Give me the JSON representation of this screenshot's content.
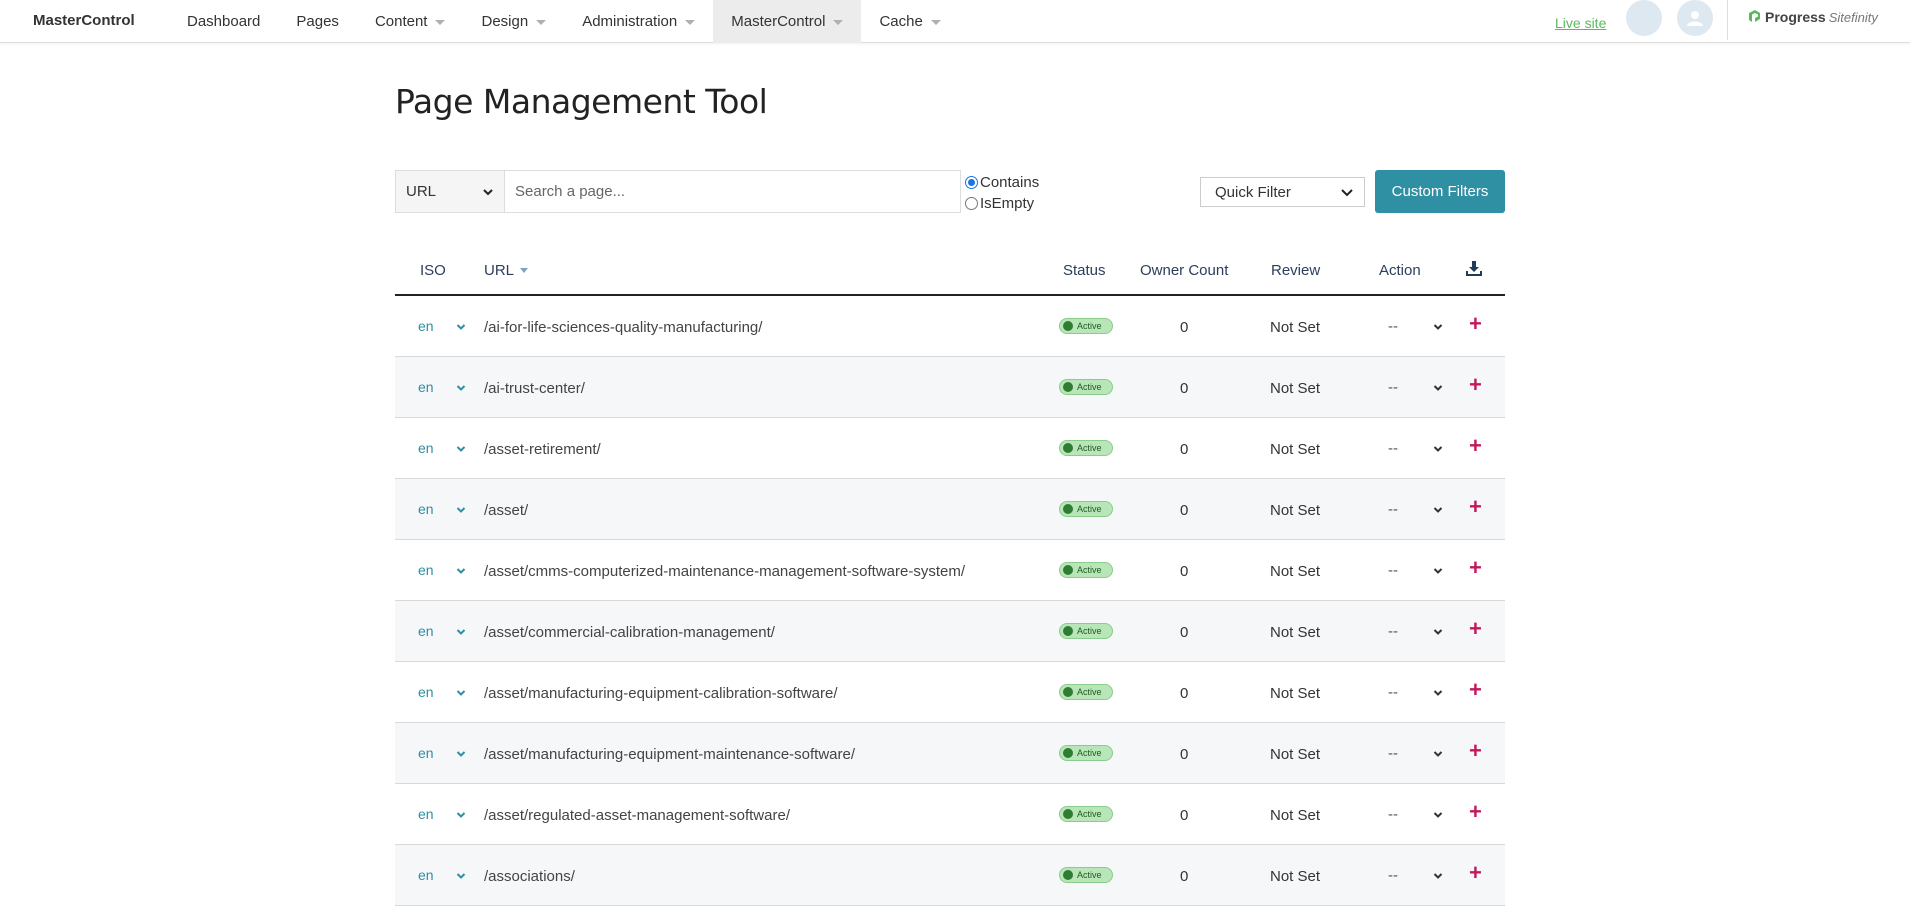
{
  "nav": {
    "brand": "MasterControl",
    "items": [
      {
        "label": "Dashboard",
        "dropdown": false,
        "active": false
      },
      {
        "label": "Pages",
        "dropdown": false,
        "active": false
      },
      {
        "label": "Content",
        "dropdown": true,
        "active": false
      },
      {
        "label": "Design",
        "dropdown": true,
        "active": false
      },
      {
        "label": "Administration",
        "dropdown": true,
        "active": false
      },
      {
        "label": "MasterControl",
        "dropdown": true,
        "active": true
      },
      {
        "label": "Cache",
        "dropdown": true,
        "active": false
      }
    ],
    "live_site": "Live site",
    "logo_progress": "Progress",
    "logo_sitefinity": "Sitefinity"
  },
  "page": {
    "title": "Page Management Tool"
  },
  "search": {
    "type_value": "URL",
    "placeholder": "Search a page...",
    "mode_options": [
      {
        "label": "Contains",
        "checked": true
      },
      {
        "label": "IsEmpty",
        "checked": false
      }
    ],
    "quick_filter": "Quick Filter",
    "custom_filters_label": "Custom Filters"
  },
  "table": {
    "headers": {
      "iso": "ISO",
      "url": "URL",
      "status": "Status",
      "owner_count": "Owner Count",
      "review": "Review",
      "action": "Action"
    },
    "rows": [
      {
        "iso": "en",
        "url": "/ai-for-life-sciences-quality-manufacturing/",
        "status": "Active",
        "owner_count": "0",
        "review": "Not Set",
        "action": "--"
      },
      {
        "iso": "en",
        "url": "/ai-trust-center/",
        "status": "Active",
        "owner_count": "0",
        "review": "Not Set",
        "action": "--"
      },
      {
        "iso": "en",
        "url": "/asset-retirement/",
        "status": "Active",
        "owner_count": "0",
        "review": "Not Set",
        "action": "--"
      },
      {
        "iso": "en",
        "url": "/asset/",
        "status": "Active",
        "owner_count": "0",
        "review": "Not Set",
        "action": "--"
      },
      {
        "iso": "en",
        "url": "/asset/cmms-computerized-maintenance-management-software-system/",
        "status": "Active",
        "owner_count": "0",
        "review": "Not Set",
        "action": "--"
      },
      {
        "iso": "en",
        "url": "/asset/commercial-calibration-management/",
        "status": "Active",
        "owner_count": "0",
        "review": "Not Set",
        "action": "--"
      },
      {
        "iso": "en",
        "url": "/asset/manufacturing-equipment-calibration-software/",
        "status": "Active",
        "owner_count": "0",
        "review": "Not Set",
        "action": "--"
      },
      {
        "iso": "en",
        "url": "/asset/manufacturing-equipment-maintenance-software/",
        "status": "Active",
        "owner_count": "0",
        "review": "Not Set",
        "action": "--"
      },
      {
        "iso": "en",
        "url": "/asset/regulated-asset-management-software/",
        "status": "Active",
        "owner_count": "0",
        "review": "Not Set",
        "action": "--"
      },
      {
        "iso": "en",
        "url": "/associations/",
        "status": "Active",
        "owner_count": "0",
        "review": "Not Set",
        "action": "--"
      }
    ]
  },
  "colors": {
    "accent": "#2f8fa3",
    "add": "#c2185b",
    "status_active": "#2e7d32",
    "live_site": "#5cb85c"
  }
}
